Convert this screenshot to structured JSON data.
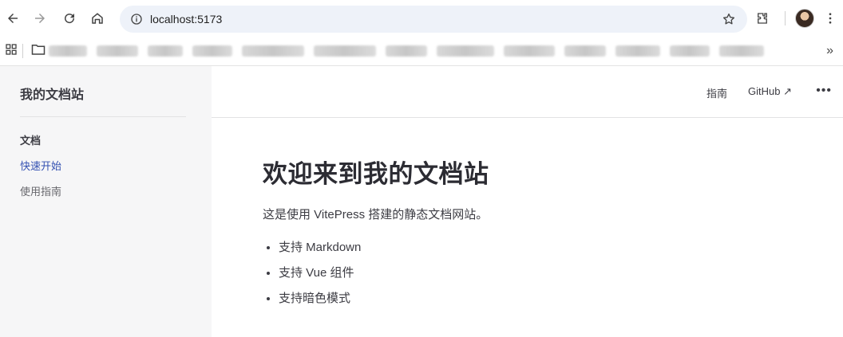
{
  "browser": {
    "url": "localhost:5173",
    "icons": {
      "back": "arrow-left-icon",
      "forward": "arrow-right-icon",
      "reload": "reload-icon",
      "home": "home-icon",
      "info": "info-icon",
      "bookmark": "star-icon",
      "extensions": "puzzle-icon",
      "menu": "kebab-menu-icon"
    }
  },
  "site": {
    "title": "我的文档站"
  },
  "sidebar": {
    "group_title": "文档",
    "items": [
      {
        "label": "快速开始",
        "active": true
      },
      {
        "label": "使用指南",
        "active": false
      }
    ]
  },
  "nav": {
    "links": [
      {
        "label": "指南"
      },
      {
        "label": "GitHub ↗"
      }
    ],
    "more": "•••"
  },
  "content": {
    "heading": "欢迎来到我的文档站",
    "intro": "这是使用 VitePress 搭建的静态文档网站。",
    "features": [
      "支持 Markdown",
      "支持 Vue 组件",
      "支持暗色模式"
    ]
  },
  "colors": {
    "accent": "#3451b2",
    "sidebar_bg": "#f6f6f7",
    "text": "#3c3c43"
  }
}
